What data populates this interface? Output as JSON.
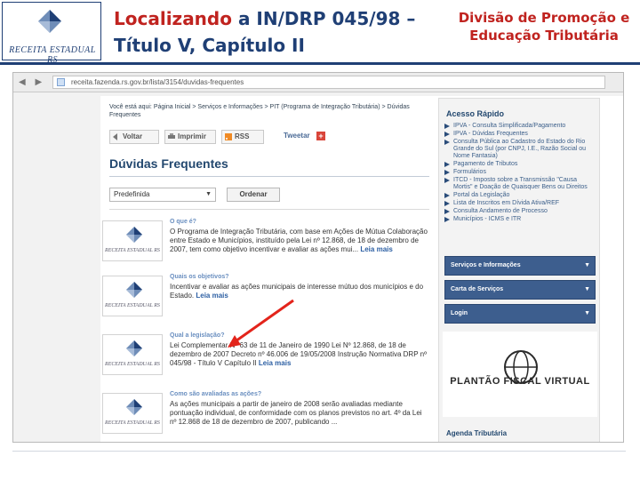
{
  "slide": {
    "logo_text": "RECEITA ESTADUAL RS",
    "title_prefix": "Localizando ",
    "title_highlight": "a IN/DRP 045/98 –",
    "title_line2": "Título V, Capítulo II",
    "division": "Divisão de Promoção e Educação Tributária"
  },
  "browser": {
    "url": "receita.fazenda.rs.gov.br/lista/3154/duvidas-frequentes"
  },
  "page": {
    "breadcrumb": "Você está aqui: Página Inicial > Serviços e Informações > PIT (Programa de Integração Tributária) > Dúvidas Frequentes",
    "toolbar": {
      "back": "Voltar",
      "print": "Imprimir",
      "rss": "RSS",
      "tweet": "Tweetar"
    },
    "title": "Dúvidas Frequentes",
    "filter": {
      "select_value": "Predefinida",
      "order_button": "Ordenar"
    },
    "thumb_text": "RECEITA ESTADUAL RS",
    "read_more": "Leia mais",
    "faqs": [
      {
        "question": "O que é?",
        "answer": "O Programa de Integração Tributária, com base em Ações de Mútua Colaboração entre Estado e Municípios, instituído pela Lei nº 12.868, de 18 de dezembro de 2007, tem como objetivo incentivar e avaliar as ações mui..."
      },
      {
        "question": "Quais os objetivos?",
        "answer": "Incentivar e avaliar as ações municipais de interesse mútuo dos municípios e do Estado."
      },
      {
        "question": "Qual a legislação?",
        "answer": "Lei Complementar Nº 63 de 11 de Janeiro de 1990 Lei Nº 12.868, de 18 de dezembro de 2007 Decreto nº 46.006 de 19/05/2008 Instrução Normativa DRP nº 045/98 - Título V Capítulo II"
      },
      {
        "question": "Como são avaliadas as ações?",
        "answer": "As ações municipais a partir de janeiro de 2008 serão avaliadas mediante pontuação individual, de conformidade com os planos previstos no art. 4º da Lei nº 12.868 de 18 de dezembro de 2007, publicando ..."
      }
    ]
  },
  "sidebar": {
    "quick_access_title": "Acesso Rápido",
    "quick_links": [
      "IPVA - Consulta Simplificada/Pagamento",
      "IPVA - Dúvidas Frequentes",
      "Consulta Pública ao Cadastro do Estado do Rio Grande do Sul (por CNPJ, I.E., Razão Social ou Nome Fantasia)",
      "Pagamento de Tributos",
      "Formulários",
      "ITCD - Imposto sobre a Transmissão \"Causa Mortis\" e Doação de Quaisquer Bens ou Direitos",
      "Portal da Legislação",
      "Lista de Inscritos em Dívida Ativa/REF",
      "Consulta Andamento de Processo",
      "Municípios - ICMS e ITR"
    ],
    "menu_buttons": [
      "Serviços e Informações",
      "Carta de Serviços",
      "Login"
    ],
    "plantao": "PLANTÃO FISCAL VIRTUAL",
    "agenda": "Agenda Tributária"
  },
  "colors": {
    "brand_blue": "#1f3f75",
    "title_red": "#c0231f",
    "arrow_red": "#e3241b"
  }
}
